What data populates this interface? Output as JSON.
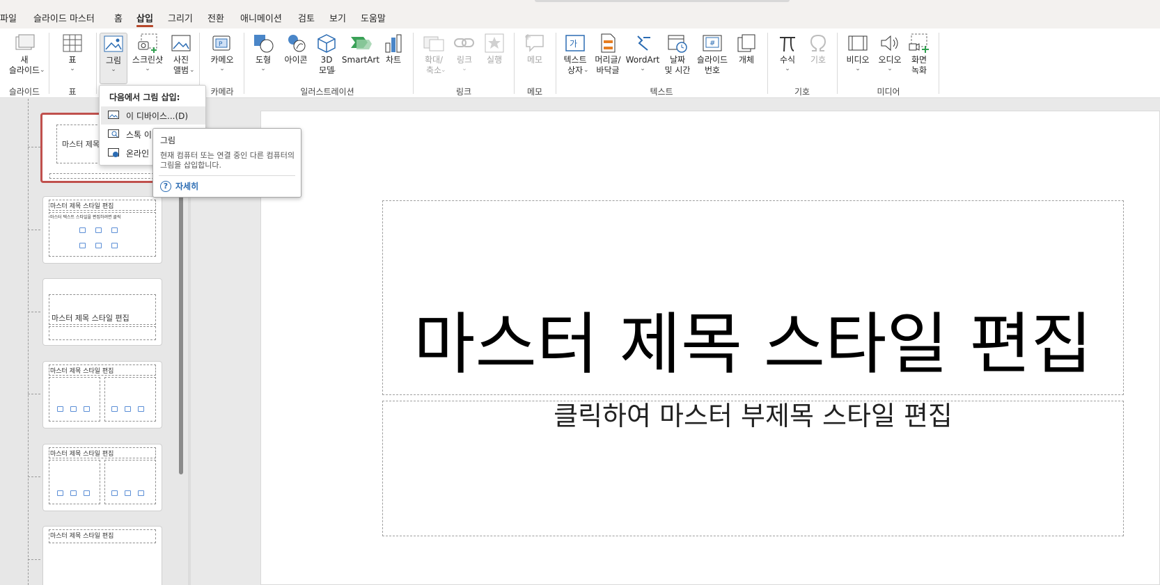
{
  "menu": {
    "tabs": [
      "파일",
      "슬라이드 마스터",
      "홈",
      "삽입",
      "그리기",
      "전환",
      "애니메이션",
      "검토",
      "보기",
      "도움말"
    ],
    "active": "삽입"
  },
  "ribbon": {
    "buttons": {
      "new_slide": "새\n슬라이드",
      "table": "표",
      "picture": "그림",
      "screenshot": "스크린샷",
      "photo_album": "사진\n앨범",
      "cameo": "카메오",
      "shapes": "도형",
      "icons": "아이콘",
      "model_3d": "3D\n모델",
      "smartart": "SmartArt",
      "chart": "차트",
      "zoom": "확대/\n축소",
      "link": "링크",
      "action": "실행",
      "comment": "메모",
      "textbox": "텍스트\n상자",
      "header_footer": "머리글/\n바닥글",
      "wordart": "WordArt",
      "date_time": "날짜\n및 시간",
      "slide_number": "슬라이드\n번호",
      "object": "개체",
      "equation": "수식",
      "symbol": "기호",
      "video": "비디오",
      "audio": "오디오",
      "screen_recording": "화면\n녹화"
    },
    "groups": {
      "slides": "슬라이드",
      "tables": "표",
      "camera": "카메라",
      "illustrations": "일러스트레이션",
      "links": "링크",
      "comments": "메모",
      "text": "텍스트",
      "symbols": "기호",
      "media": "미디어"
    }
  },
  "dropdown": {
    "header": "다음에서 그림 삽입:",
    "items": [
      "이 디바이스...(D)",
      "스톡 이",
      "온라인"
    ]
  },
  "tooltip": {
    "title": "그림",
    "description": "현재 컴퓨터 또는 연결 중인 다른 컴퓨터의 그림을 삽입합니다.",
    "more": "자세히"
  },
  "thumbnails": {
    "master_title": "마스터 제목",
    "title_text": "마스터 제목 스타일 편집",
    "body_text": "마스터 텍스트 스타일을 편집하려면 클릭"
  },
  "slide": {
    "title": "마스터 제목 스타일 편집",
    "subtitle": "클릭하여 마스터 부제목 스타일 편집"
  },
  "colors": {
    "accent": "#b7472a",
    "selection": "#c0504d",
    "link": "#2b6cb3"
  }
}
